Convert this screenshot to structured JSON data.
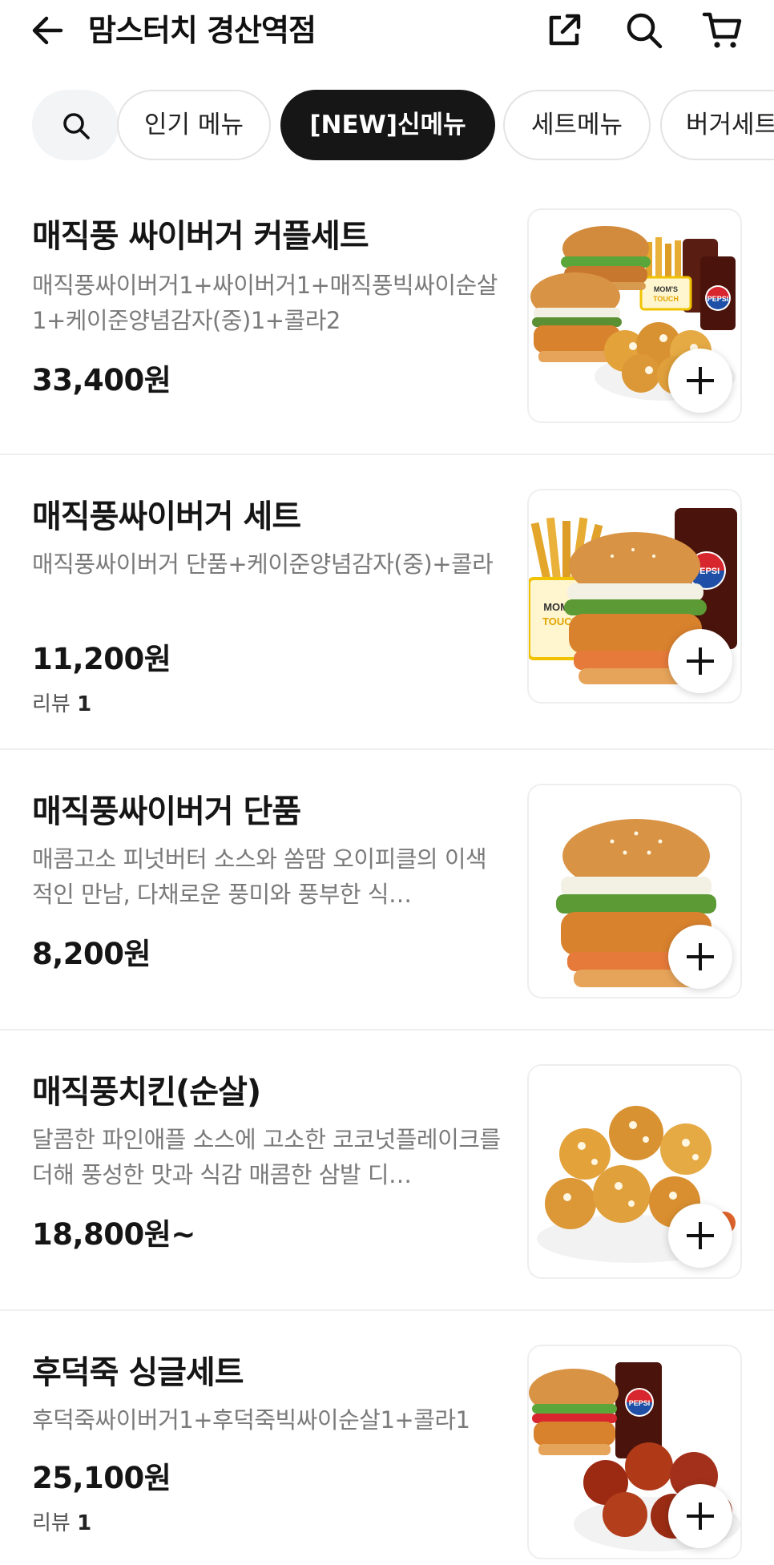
{
  "header": {
    "title": "맘스터치 경산역점",
    "icons": [
      "back-arrow-icon",
      "share-icon",
      "search-icon",
      "cart-icon"
    ]
  },
  "categories": {
    "search_icon": "search-icon",
    "chips": [
      {
        "label": "인기 메뉴",
        "active": false
      },
      {
        "label": "[NEW]신메뉴",
        "active": true
      },
      {
        "label": "세트메뉴",
        "active": false
      },
      {
        "label": "버거세트",
        "active": false
      }
    ]
  },
  "menu": [
    {
      "name": "매직풍 싸이버거 커플세트",
      "description": "매직풍싸이버거1+싸이버거1+매직풍빅싸이순살1+케이준양념감자(중)1+콜라2",
      "price": "33,400원",
      "review_label": "",
      "review_count": ""
    },
    {
      "name": "매직풍싸이버거 세트",
      "description": "매직풍싸이버거 단품+케이준양념감자(중)+콜라",
      "price": "11,200원",
      "review_label": "리뷰",
      "review_count": "1"
    },
    {
      "name": "매직풍싸이버거 단품",
      "description": "매콤고소 피넛버터 소스와 쏨땀 오이피클의 이색적인 만남, 다채로운 풍미와 풍부한 식…",
      "price": "8,200원",
      "review_label": "",
      "review_count": ""
    },
    {
      "name": "매직풍치킨(순살)",
      "description": "달콤한 파인애플 소스에 고소한 코코넛플레이크를 더해 풍성한 맛과 식감 매콤한 삼발 디…",
      "price": "18,800원~",
      "review_label": "",
      "review_count": ""
    },
    {
      "name": "후덕죽 싱글세트",
      "description": "후덕죽싸이버거1+후덕죽빅싸이순살1+콜라1",
      "price": "25,100원",
      "review_label": "리뷰",
      "review_count": "1"
    }
  ],
  "image_text": {
    "pepsi": "PEPSI",
    "moms": "MOM'S",
    "touch": "TOUCH"
  },
  "colors": {
    "active_chip": "#161616",
    "text_primary": "#151515",
    "text_secondary": "#7a7a7a",
    "pepsi_blue": "#1f4fa6",
    "pepsi_red": "#d7262d"
  }
}
